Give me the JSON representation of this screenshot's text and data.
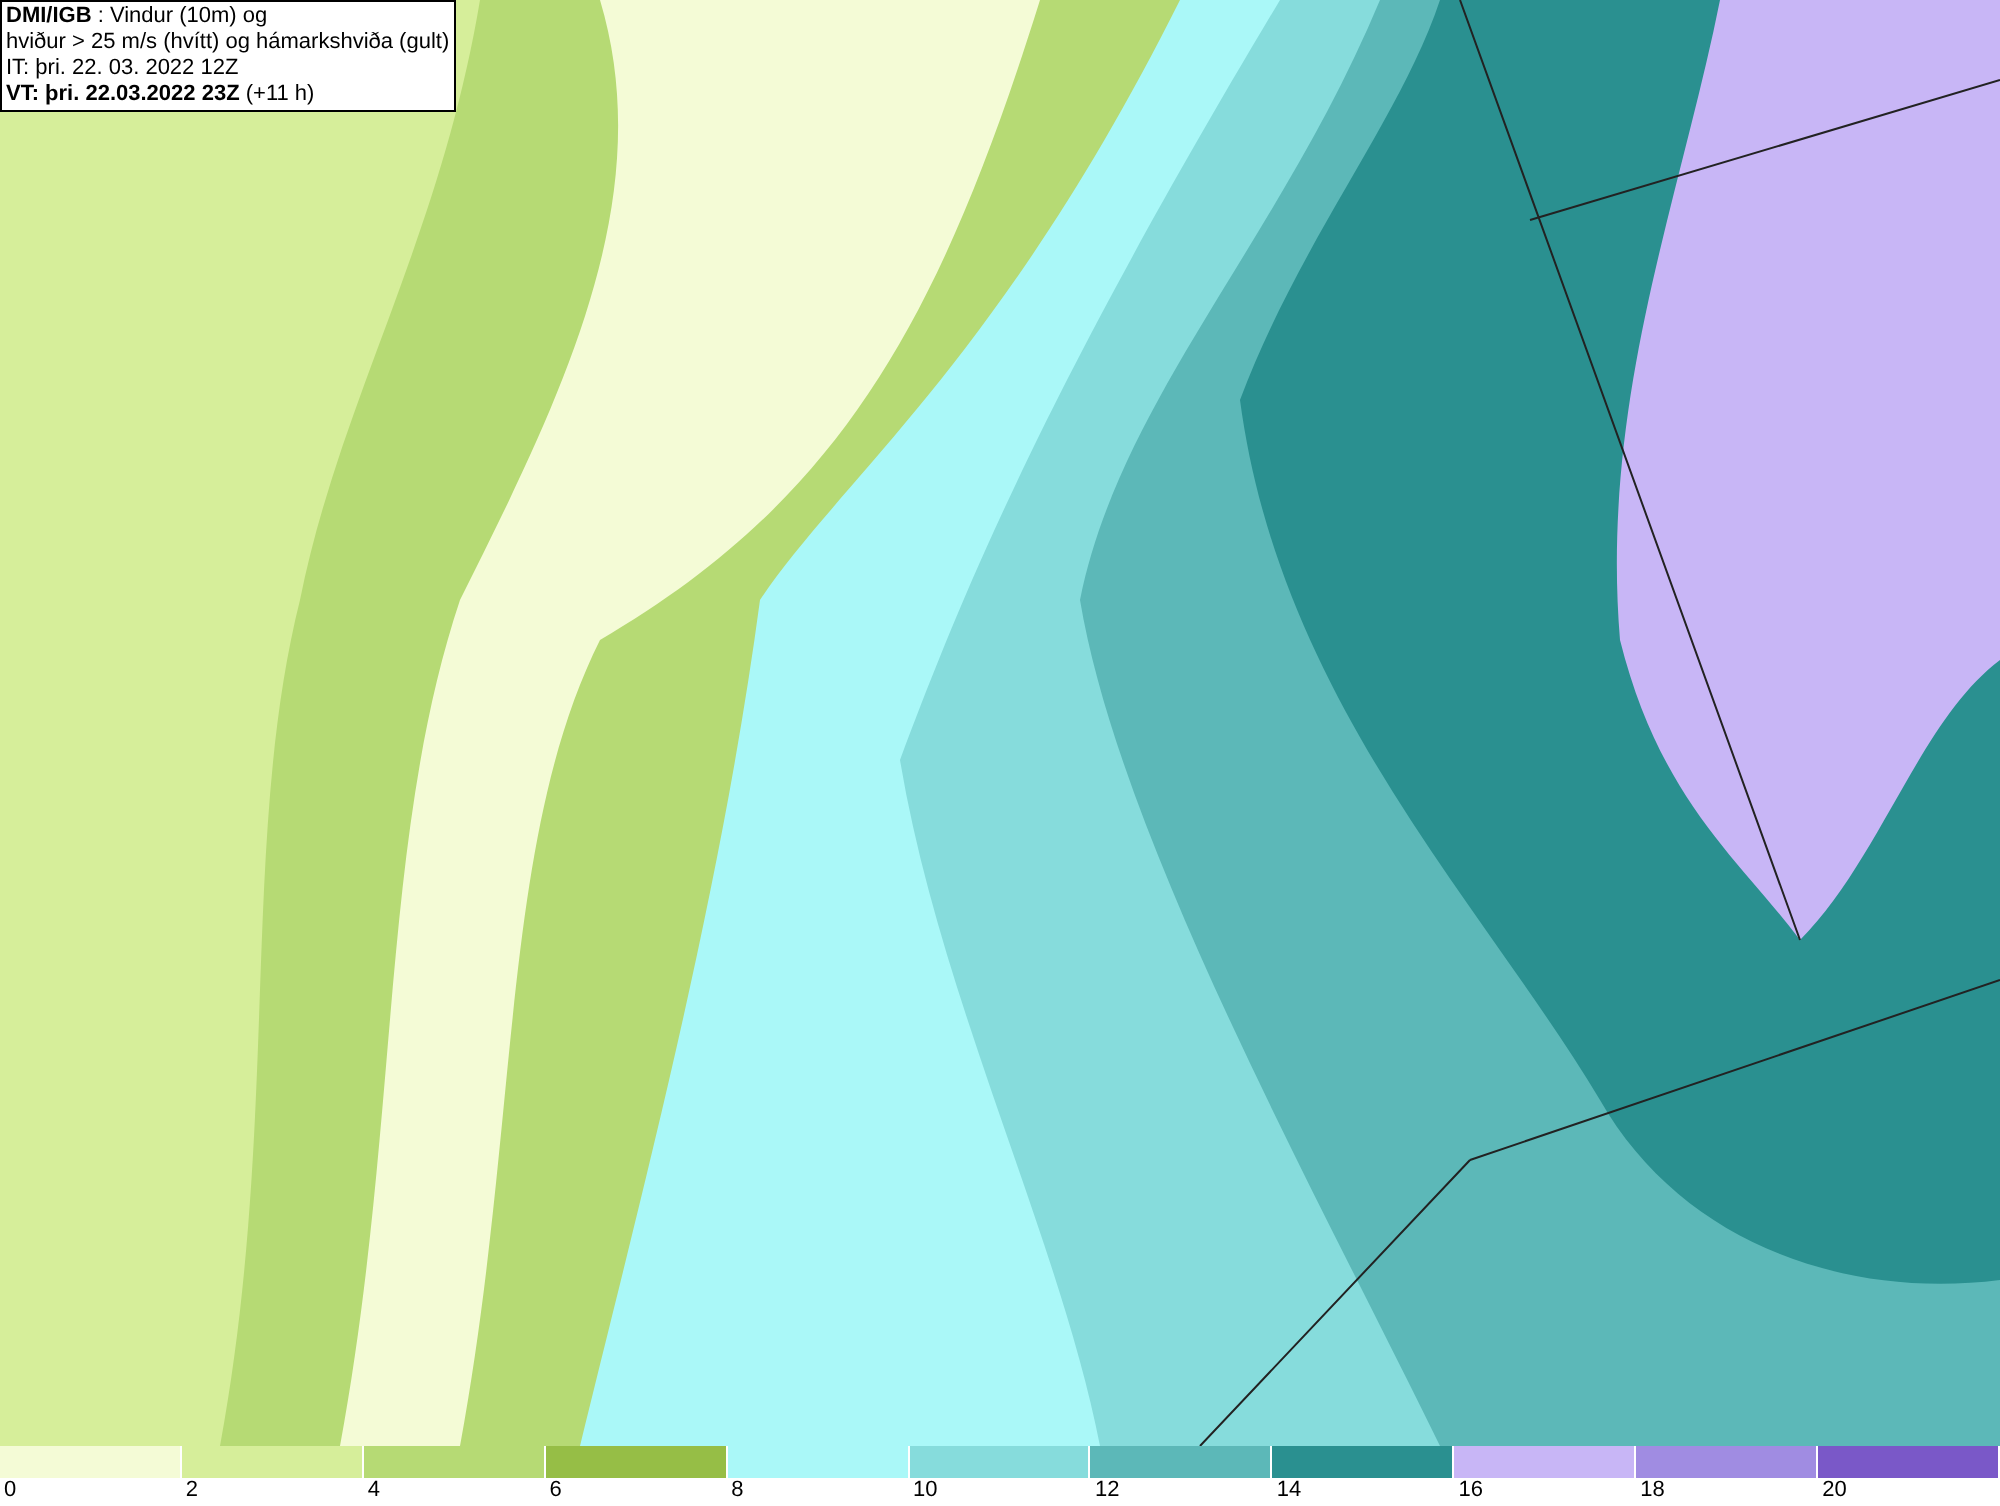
{
  "info_box": {
    "lines": [
      "**DMI/IGB** : Vindur (10m) og",
      "hviður > 25 m/s (hvítt) og hámarkshviða (gult)",
      "IT: þri. 22. 03. 2022 12Z",
      "**VT: þri. 22.03.2022 23Z** (+11 h)"
    ]
  },
  "legend": {
    "bins": [
      {
        "color": "#f4fbd6"
      },
      {
        "color": "#d6ee9a"
      },
      {
        "color": "#b6da74"
      },
      {
        "color": "#96be46"
      },
      {
        "color": "#aaf8f8"
      },
      {
        "color": "#86dcdc"
      },
      {
        "color": "#5cb8b8"
      },
      {
        "color": "#2a9090"
      },
      {
        "color": "#c8b6f6"
      },
      {
        "color": "#a08ce2"
      },
      {
        "color": "#7a58c8"
      }
    ],
    "ticks": [
      "0",
      "2",
      "4",
      "6",
      "8",
      "10",
      "12",
      "14",
      "16",
      "18",
      "20"
    ]
  }
}
